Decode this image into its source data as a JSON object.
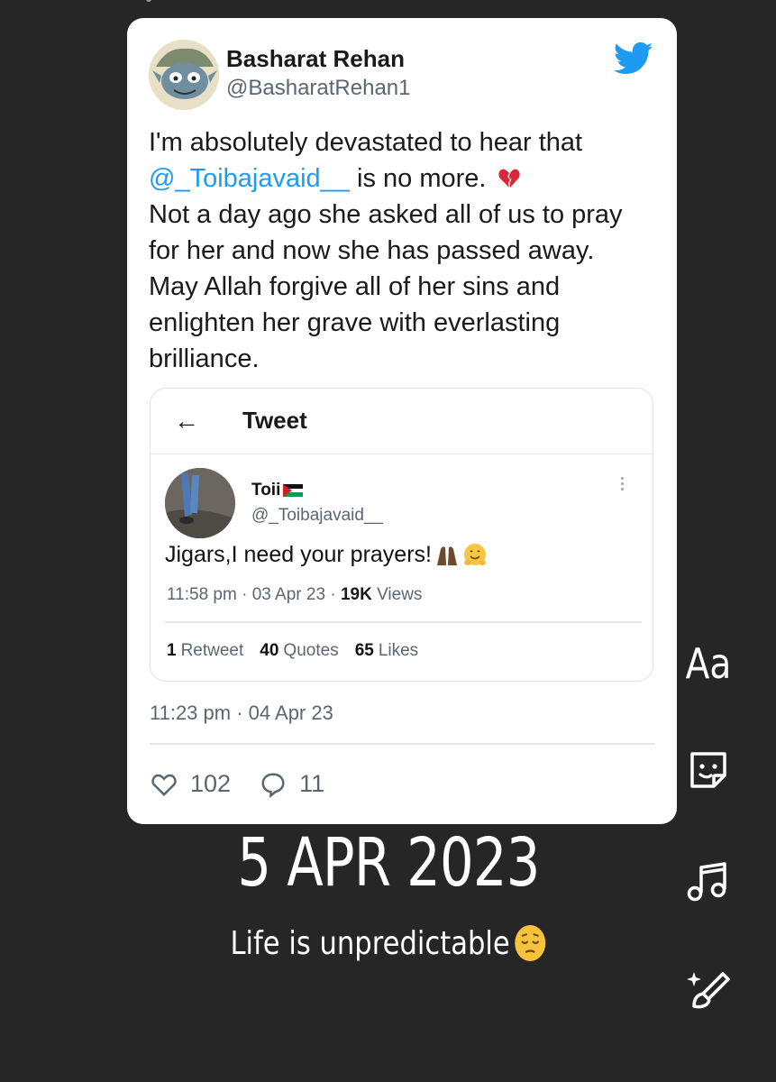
{
  "story": {
    "date_text": "5 APR 2023",
    "caption": "Life is unpredictable",
    "caption_emoji": "pensive-face",
    "tools": {
      "text_label": "Aa",
      "sticker": "sticker-icon",
      "music": "music-note-icon",
      "effects": "sparkle-brush-icon"
    }
  },
  "tweet": {
    "author_name": "Basharat Rehan",
    "author_handle": "@BasharatRehan1",
    "text_intro": "I'm absolutely devastated to hear that",
    "mention": "@_Toibajavaid__",
    "text_after_mention": "is no more.",
    "text_rest": "Not a day ago she asked all of us to pray for her and now she has passed away. May Allah forgive all of her sins and enlighten her grave with everlasting brilliance.",
    "timestamp": "11:23 pm · 04 Apr 23",
    "likes": "102",
    "replies": "11",
    "brand_color": "#1d9bf0"
  },
  "quoted": {
    "header_title": "Tweet",
    "author_name": "Toii",
    "author_handle": "@_Toibajavaid__",
    "text": "Jigars,I need your prayers!",
    "time": "11:58 pm · 03 Apr 23 · ",
    "views_count": "19K",
    "views_label": "Views",
    "retweets_count": "1",
    "retweets_label": "Retweet",
    "quotes_count": "40",
    "quotes_label": "Quotes",
    "likes_count": "65",
    "likes_label": "Likes"
  }
}
